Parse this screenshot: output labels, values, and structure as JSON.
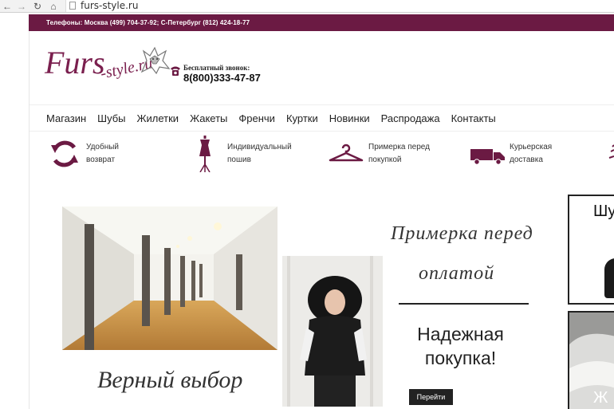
{
  "browser": {
    "url": "furs-style.ru"
  },
  "topbar": {
    "phones": "Телефоны: Москва (499) 704-37-92; С-Петербург (812) 424-18-77"
  },
  "logo": {
    "part1": "Furs",
    "part2": "-style.ru"
  },
  "freecall": {
    "label": "Бесплатный звонок:",
    "number": "8(800)333-47-87"
  },
  "menu": [
    "Магазин",
    "Шубы",
    "Жилетки",
    "Жакеты",
    "Френчи",
    "Куртки",
    "Новинки",
    "Распродажа",
    "Контакты"
  ],
  "features": [
    {
      "icon": "return-arrows-icon",
      "line1": "Удобный",
      "line2": "возврат"
    },
    {
      "icon": "mannequin-icon",
      "line1": "Индивидуальный",
      "line2": "пошив"
    },
    {
      "icon": "hanger-icon",
      "line1": "Примерка перед",
      "line2": "покупкой"
    },
    {
      "icon": "delivery-truck-icon",
      "line1": "Курьерская",
      "line2": "доставка"
    }
  ],
  "promo": {
    "script_line1": "Примерка перед",
    "script_line2": "оплатой",
    "heading_line1": "Надежная",
    "heading_line2": "покупка!",
    "button": "Перейти",
    "bottom_script": "Верный выбор"
  },
  "tiles": {
    "tile1_text": "Шу",
    "tile2_text": "Ж"
  },
  "colors": {
    "brand": "#6b1a43",
    "brand_icon": "#7a1f4e"
  }
}
